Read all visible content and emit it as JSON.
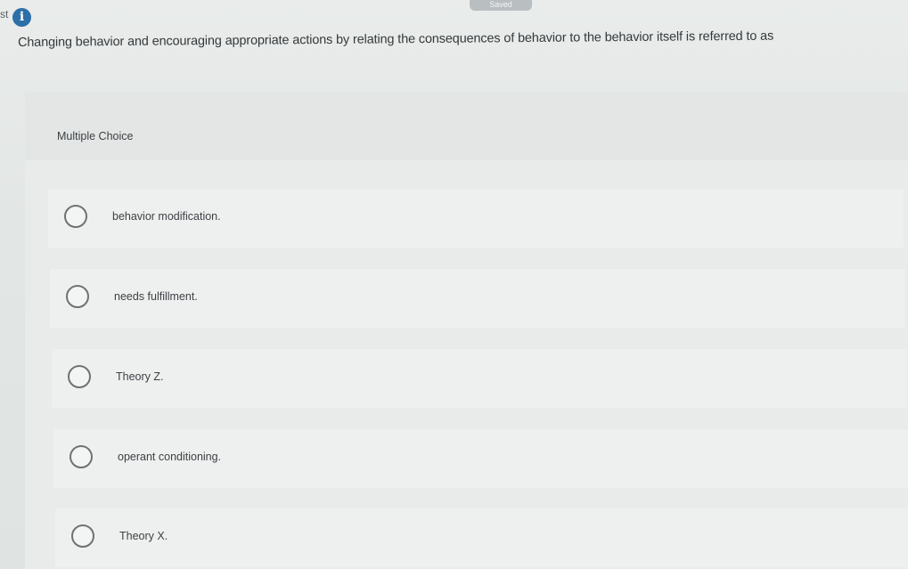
{
  "header": {
    "partial_label": "st",
    "info_icon": "info-icon",
    "saved_label": "Saved"
  },
  "question": {
    "text": "Changing behavior and encouraging appropriate actions by relating the consequences of behavior to the behavior itself is referred to as"
  },
  "choices": {
    "title": "Multiple Choice",
    "options": [
      {
        "label": "behavior modification."
      },
      {
        "label": "needs fulfillment."
      },
      {
        "label": "Theory Z."
      },
      {
        "label": "operant conditioning."
      },
      {
        "label": "Theory X."
      }
    ]
  },
  "colors": {
    "accent": "#2c6ea8",
    "background": "#e4e7e6",
    "text": "#33383c"
  }
}
